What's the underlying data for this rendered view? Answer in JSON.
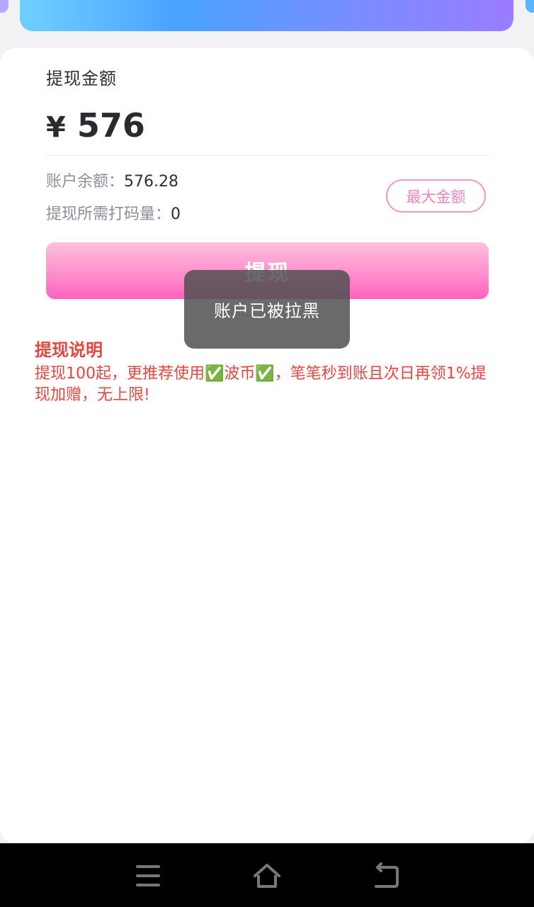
{
  "withdraw": {
    "amount_label": "提现金额",
    "currency_symbol": "¥",
    "amount_value": "576",
    "balance_label": "账户余额：",
    "balance_value": "576.28",
    "wager_label": "提现所需打码量：",
    "wager_value": "0",
    "max_label": "最大金额",
    "button_label": "提现"
  },
  "toast": {
    "message": "账户已被拉黑"
  },
  "notes": {
    "title": "提现说明",
    "body": "提现100起，更推荐使用✅波币✅，笔笔秒到账且次日再领1%提现加赠，无上限!"
  },
  "navigation": {
    "items": [
      "menu-icon",
      "home-icon",
      "back-icon"
    ]
  },
  "colors": {
    "accent_pink": "#ff7fc8",
    "note_red": "#e4473f",
    "top_gradient_start": "#6fd0ff",
    "top_gradient_end": "#9a7dff"
  }
}
